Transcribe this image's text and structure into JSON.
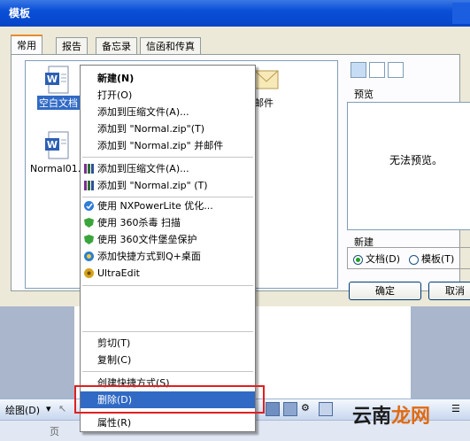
{
  "dialog": {
    "title": "模板",
    "tabs": [
      "常用",
      "报告",
      "备忘录",
      "信函和传真"
    ],
    "files": [
      {
        "label": "空白文档"
      },
      {
        "label": "Normal01."
      },
      {
        "label": "邮件"
      }
    ],
    "preview_label": "预览",
    "no_preview": "无法预览。",
    "new_label": "新建",
    "radio_doc": "文档(D)",
    "radio_template": "模板(T)",
    "ok_button": "确定",
    "cancel_button": "取消"
  },
  "context_menu": {
    "items": [
      {
        "label": "新建(N)",
        "bold": true
      },
      {
        "label": "打开(O)"
      },
      {
        "label": "添加到压缩文件(A)..."
      },
      {
        "label": "添加到 \"Normal.zip\"(T)"
      },
      {
        "label": "添加到 \"Normal.zip\" 并邮件"
      },
      {
        "label": "添加到压缩文件(A)..."
      },
      {
        "label": "添加到 \"Normal.zip\" (T)"
      },
      {
        "label": "使用 NXPowerLite 优化..."
      },
      {
        "label": "使用 360杀毒 扫描"
      },
      {
        "label": "使用 360文件堡垒保护"
      },
      {
        "label": "添加快捷方式到Q+桌面"
      },
      {
        "label": "UltraEdit"
      },
      {
        "label": "剪切(T)"
      },
      {
        "label": "复制(C)"
      },
      {
        "label": "创建快捷方式(S)"
      },
      {
        "label": "删除(D)"
      },
      {
        "label": "属性(R)"
      }
    ]
  },
  "toolbar": {
    "draw_label": "绘图(D)"
  },
  "statusbar": {
    "page_text": "页"
  },
  "watermark": {
    "part1": "云南",
    "part2": "龙网"
  },
  "colors": {
    "selection": "#316ac5",
    "titlebar": "#0a4fd8",
    "highlight_box": "#e02020"
  }
}
